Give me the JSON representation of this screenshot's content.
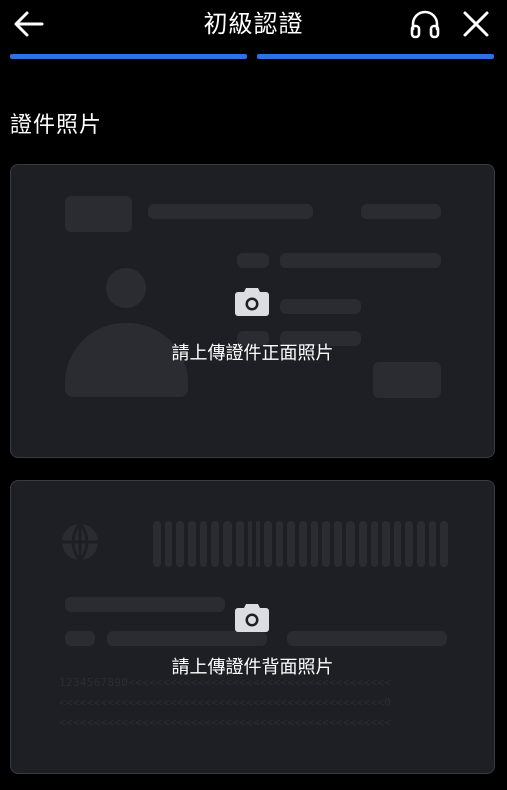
{
  "header": {
    "title": "初級認證",
    "back_icon": "arrow-left-icon",
    "support_icon": "headphones-icon",
    "close_icon": "close-icon"
  },
  "progress": {
    "steps_total": 2,
    "steps_complete": 2,
    "color": "#2f6fe8"
  },
  "section": {
    "title": "證件照片"
  },
  "front_card": {
    "label": "請上傳證件正面照片",
    "icon": "camera-icon"
  },
  "back_card": {
    "label": "請上傳證件背面照片",
    "icon": "camera-icon",
    "mrz_lines": [
      "1234567890<<<<<<<<<<<<<<<<<<<<<<<<<<<<<<<<<<<<<<",
      "<<<<<<<<<<<<<<<<<<<<<<<<<<<<<<<<<<<<<<<<<<<<<<<0",
      "<<<<<<<<<<<<<<<<<<<<<<<<<<<<<<<<<<<<<<<<<<<<<<<<"
    ]
  },
  "colors": {
    "background": "#000000",
    "card": "#1e1f24",
    "placeholder": "#2b2c32",
    "accent": "#2f6fe8"
  }
}
